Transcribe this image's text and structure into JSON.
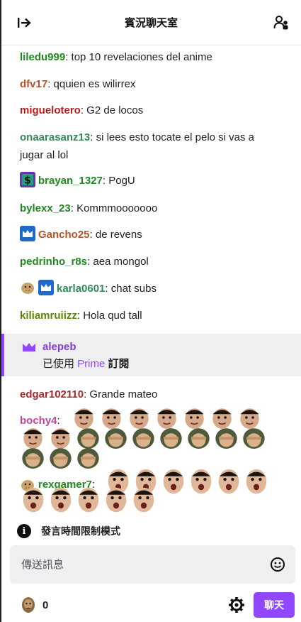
{
  "header": {
    "title": "賓況聊天室",
    "collapse_icon": "collapse-arrow-icon",
    "users_icon": "community-icon"
  },
  "messages": [
    {
      "user": "liledu999",
      "color": "#1e8a1e",
      "text": ": top 10 revelaciones del anime"
    },
    {
      "user": "dfv17",
      "color": "#b5532b",
      "text": ": qquien es wilirrex"
    },
    {
      "user": "miguelotero",
      "color": "#c01c1c",
      "text": ": G2 de locos"
    },
    {
      "user": "onaarasanz13",
      "color": "#2e8b57",
      "text": ": si lees esto tocate el pelo si vas a jugar al lol"
    },
    {
      "user": "brayan_1327",
      "color": "#1e8a1e",
      "text": ": PogU"
    },
    {
      "user": "bylexx_23",
      "color": "#1e8a1e",
      "text": ": Kommmooooooo"
    },
    {
      "user": "Gancho25",
      "color": "#b5532b",
      "text": ": de revens"
    },
    {
      "user": "pedrinho_r8s",
      "color": "#1e8a1e",
      "text": ": aea mongol"
    },
    {
      "user": "karla0601",
      "color": "#2e8b57",
      "text": ": chat subs"
    },
    {
      "user": "kiliamruiizz",
      "color": "#5a8a00",
      "text": ": Hola qud tall"
    }
  ],
  "prime": {
    "user": "alepeb",
    "prefix": "已使用 ",
    "prime_word": "Prime",
    "suffix": " 訂閱"
  },
  "messages2": [
    {
      "user": "edgar102110",
      "color": "#a52a2a",
      "text": ": Grande mateo"
    },
    {
      "user": "bochy4",
      "color": "#c0459b",
      "text": ":"
    },
    {
      "user": "rexgamer7",
      "color": "#1e8a1e",
      "text": ":"
    }
  ],
  "slow_mode": "發言時間限制模式",
  "input": {
    "placeholder": "傳送訊息"
  },
  "footer": {
    "points": "0",
    "chat_button": "聊天"
  },
  "colors": {
    "accent": "#9147ff",
    "badge_blue": "#1f69c8"
  }
}
